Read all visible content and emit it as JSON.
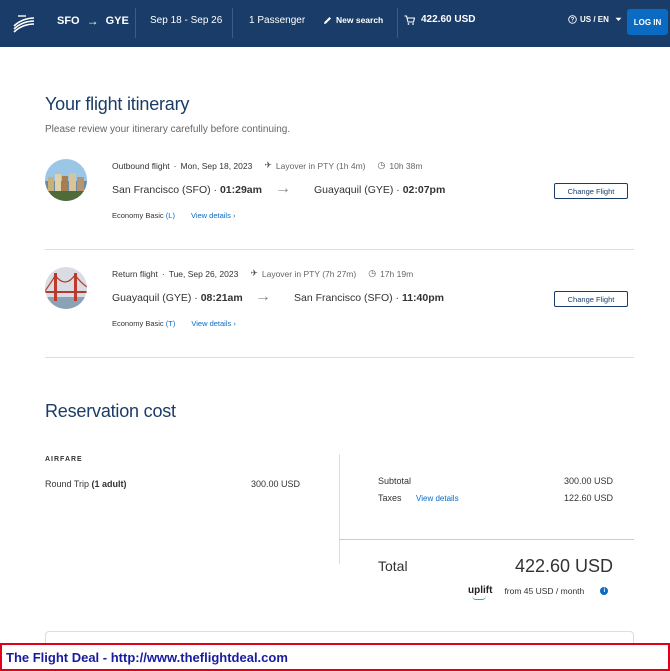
{
  "header": {
    "origin": "SFO",
    "destination": "GYE",
    "arrow": "→",
    "dates": "Sep 18 - Sep 26",
    "passengers": "1 Passenger",
    "new_search": "New search",
    "cart_total": "422.60 USD",
    "locale": "US / EN",
    "login": "LOG IN",
    "icons": [
      "airline-logo",
      "pencil-icon",
      "cart-icon",
      "help-icon",
      "chevron-down-icon"
    ]
  },
  "itinerary": {
    "title": "Your flight itinerary",
    "subtitle": "Please review your itinerary carefully before continuing.",
    "flights": [
      {
        "label": "Outbound flight",
        "date": "Mon, Sep 18, 2023",
        "layover": "Layover in PTY (1h 4m)",
        "duration": "10h 38m",
        "from_city": "San Francisco (SFO) · ",
        "from_time": "01:29am",
        "to_city": "Guayaquil (GYE) · ",
        "to_time": "02:07pm",
        "fare_class": "Economy Basic",
        "fare_code": "(L)",
        "details": "View details",
        "change": "Change Flight"
      },
      {
        "label": "Return flight",
        "date": "Tue, Sep 26, 2023",
        "layover": "Layover in PTY (7h 27m)",
        "duration": "17h 19m",
        "from_city": "Guayaquil (GYE) · ",
        "from_time": "08:21am",
        "to_city": "San Francisco (SFO) · ",
        "to_time": "11:40pm",
        "fare_class": "Economy Basic",
        "fare_code": "(T)",
        "details": "View details",
        "change": "Change Flight"
      }
    ]
  },
  "cost": {
    "title": "Reservation cost",
    "airfare_label": "AIRFARE",
    "round_trip": "Round Trip",
    "round_trip_detail": "(1 adult)",
    "round_trip_value": "300.00 USD",
    "subtotal_label": "Subtotal",
    "subtotal_value": "300.00 USD",
    "taxes_label": "Taxes",
    "taxes_link": "View details",
    "taxes_value": "122.60 USD",
    "total_label": "Total",
    "total_value": "422.60 USD",
    "uplift_brand": "uplift",
    "uplift_text": "from 45 USD  / month",
    "info_icon": "i"
  },
  "footer": {
    "text": "The Flight Deal - http://www.theflightdeal.com"
  }
}
